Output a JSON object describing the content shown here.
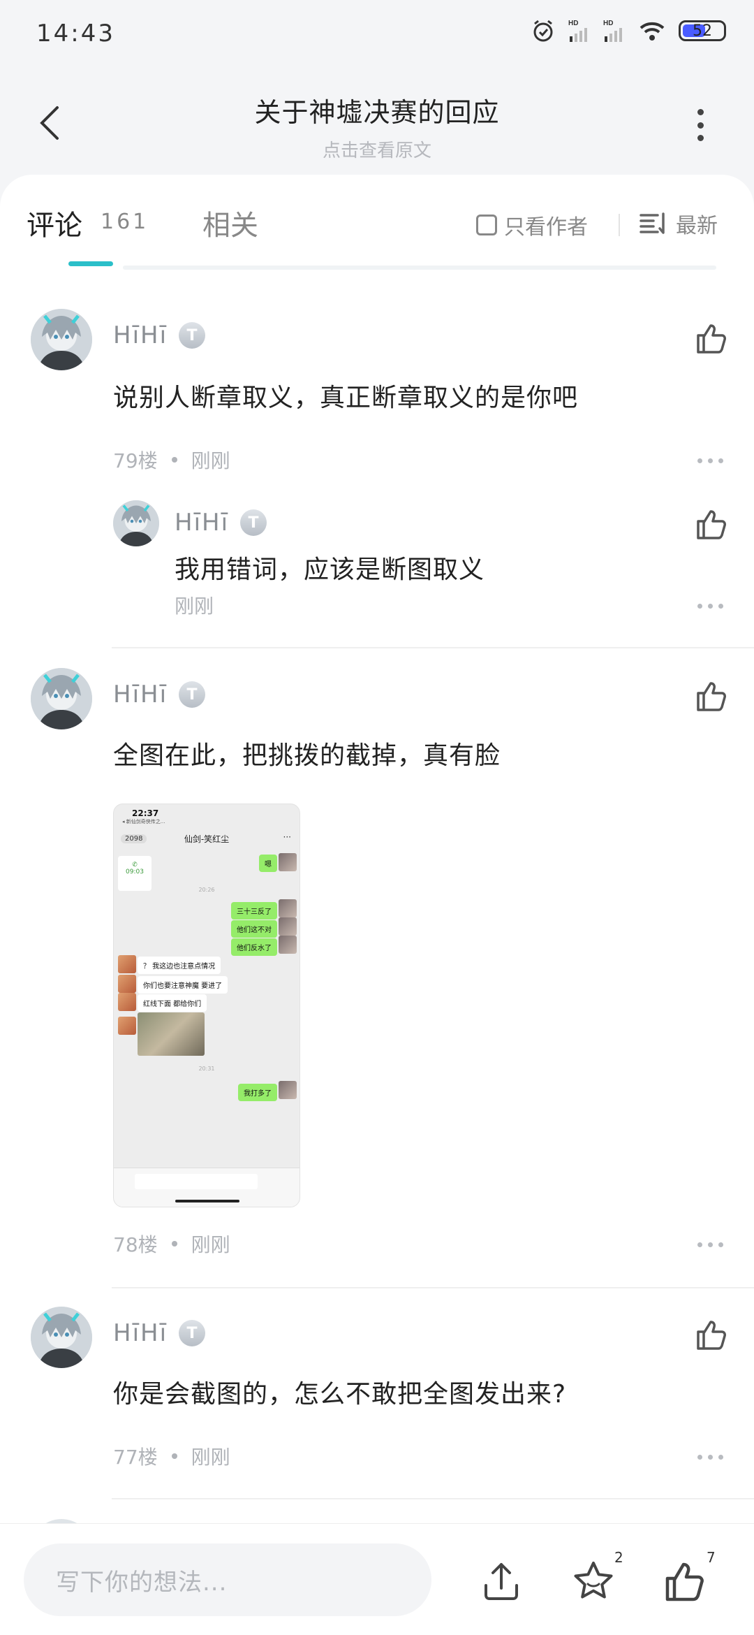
{
  "status_bar": {
    "time": "14:43",
    "battery": "52"
  },
  "header": {
    "title": "关于神墟决赛的回应",
    "subtitle": "点击查看原文"
  },
  "tabs": {
    "comments_label": "评论",
    "comments_count": "161",
    "related_label": "相关",
    "author_only_label": "只看作者",
    "sort_label": "最新"
  },
  "comments": [
    {
      "user": "HīHī",
      "badge": "T",
      "text": "说别人断章取义，真正断章取义的是你吧",
      "floor": "79楼",
      "time": "刚刚"
    },
    {
      "user": "HīHī",
      "badge": "T",
      "text": "全图在此，把挑拨的截掉，真有脸",
      "floor": "78楼",
      "time": "刚刚"
    },
    {
      "user": "HīHī",
      "badge": "T",
      "text": "你是会截图的，怎么不敢把全图发出来?",
      "floor": "77楼",
      "time": "刚刚"
    }
  ],
  "reply": {
    "user": "HīHī",
    "badge": "T",
    "text": "我用错词，应该是断图取义",
    "time": "刚刚"
  },
  "screenshot": {
    "time": "22:37",
    "subtitle": "◂ 新仙剑奇侠传之...",
    "badge": "2098",
    "chat_title": "仙剑-笑红尘",
    "call_duration": "09:03",
    "ts1": "20:26",
    "ts2": "20:31",
    "msgs_me": [
      "嗯",
      "三十三反了",
      "他们这不对",
      "他们反水了",
      "我打多了"
    ],
    "msgs_other": [
      "？ 我这边也注意点情况",
      "你们也要注意神魔 要进了",
      "红线下面 都给你们"
    ]
  },
  "bottom_bar": {
    "placeholder": "写下你的想法...",
    "star_count": "2",
    "like_count": "7"
  },
  "colors": {
    "accent": "#2bbfc9",
    "wechat_green": "#95ec69"
  }
}
